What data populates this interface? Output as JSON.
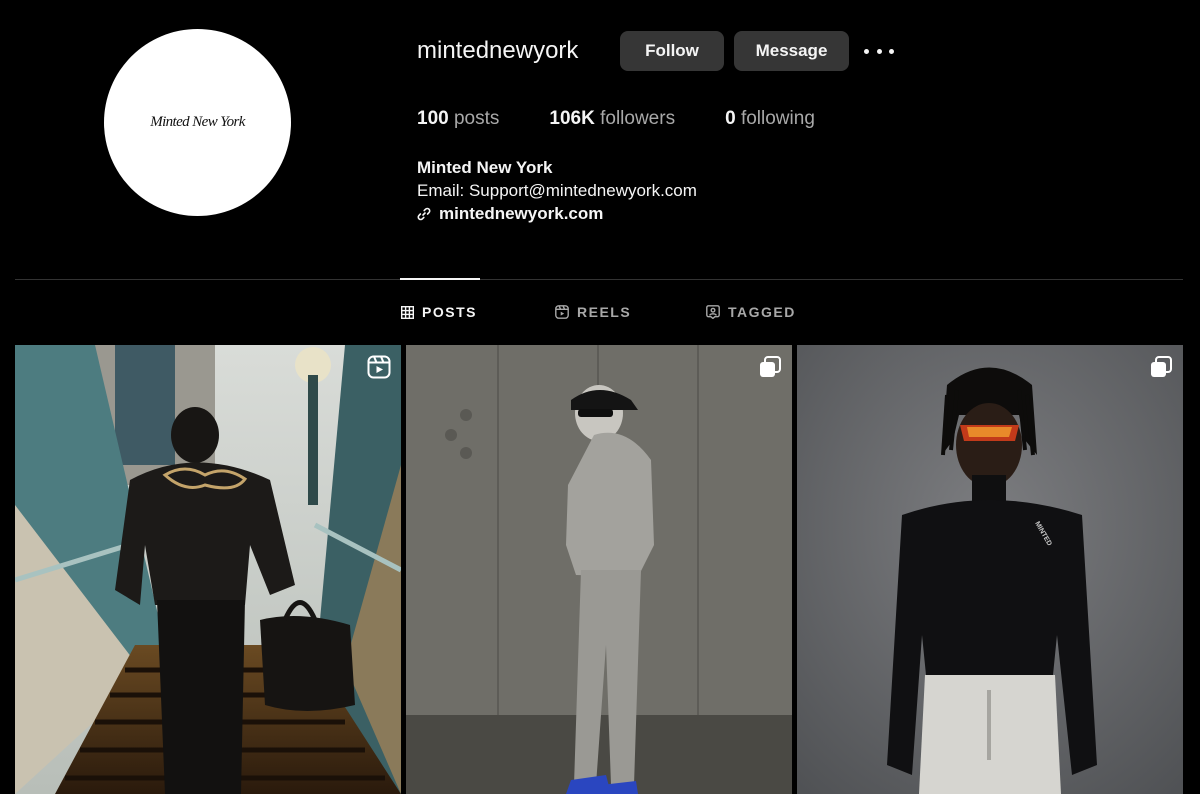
{
  "profile": {
    "avatar_text": "Minted New York",
    "username": "mintednewyork",
    "follow_label": "Follow",
    "message_label": "Message",
    "more_icon": "more-dots-icon"
  },
  "stats": [
    {
      "value": "100",
      "label": "posts"
    },
    {
      "value": "106K",
      "label": "followers"
    },
    {
      "value": "0",
      "label": "following"
    }
  ],
  "bio": {
    "name": "Minted New York",
    "email": "Email: Support@mintednewyork.com",
    "link": "mintednewyork.com",
    "link_icon": "link-icon"
  },
  "tabs": [
    {
      "label": "POSTS",
      "icon": "grid-icon",
      "active": true
    },
    {
      "label": "REELS",
      "icon": "reels-icon",
      "active": false
    },
    {
      "label": "TAGGED",
      "icon": "tagged-icon",
      "active": false
    }
  ],
  "posts": [
    {
      "type": "reel",
      "badge_icon": "reel-badge-icon"
    },
    {
      "type": "carousel",
      "badge_icon": "carousel-badge-icon"
    },
    {
      "type": "carousel",
      "badge_icon": "carousel-badge-icon"
    }
  ],
  "colors": {
    "background": "#000000",
    "button": "#363636",
    "text_primary": "#f5f5f5",
    "text_secondary": "#a8a8a8",
    "divider": "#333333"
  }
}
